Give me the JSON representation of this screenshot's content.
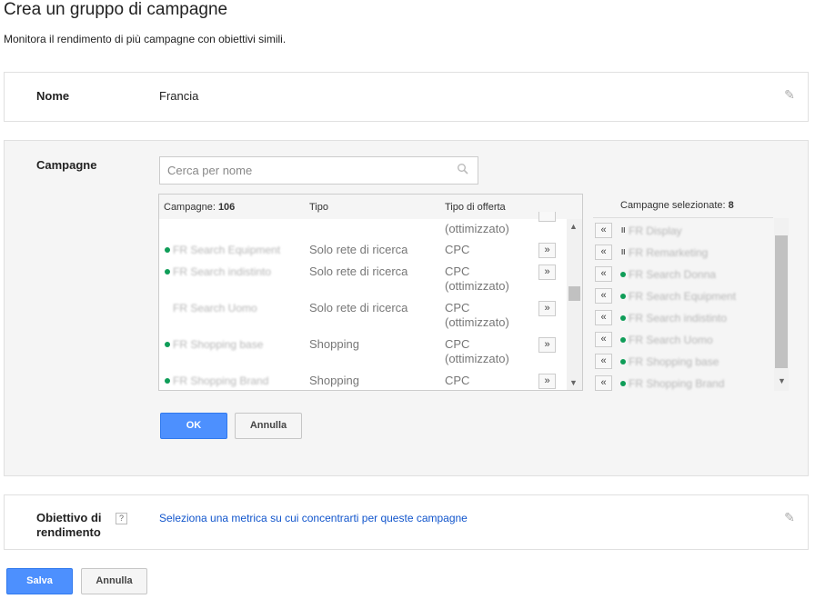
{
  "header": {
    "title": "Crea un gruppo di campagne",
    "subtitle": "Monitora il rendimento di più campagne con obiettivi simili."
  },
  "name_section": {
    "label": "Nome",
    "value": "Francia"
  },
  "campaigns_section": {
    "label": "Campagne",
    "search_placeholder": "Cerca per nome",
    "table": {
      "col_campaigns_label": "Campagne:",
      "col_campaigns_count": "106",
      "col_type": "Tipo",
      "col_bid": "Tipo di offerta",
      "top_partial_bid": "(ottimizzato)",
      "rows": [
        {
          "name": "FR Search Equipment",
          "type": "Solo rete di ricerca",
          "bid1": "CPC",
          "bid2": ""
        },
        {
          "name": "FR Search indistinto",
          "type": "Solo rete di ricerca",
          "bid1": "CPC",
          "bid2": "(ottimizzato)"
        },
        {
          "name": "FR Search Uomo",
          "type": "Solo rete di ricerca",
          "bid1": "CPC",
          "bid2": "(ottimizzato)"
        },
        {
          "name": "FR Shopping base",
          "type": "Shopping",
          "bid1": "CPC",
          "bid2": "(ottimizzato)"
        },
        {
          "name": "FR Shopping Brand",
          "type": "Shopping",
          "bid1": "CPC",
          "bid2": ""
        }
      ],
      "add_arrow": "»"
    },
    "selected": {
      "label": "Campagne selezionate:",
      "count": "8",
      "remove_arrow": "«",
      "items": [
        {
          "name": "FR Display",
          "status": "paused"
        },
        {
          "name": "FR Remarketing",
          "status": "paused"
        },
        {
          "name": "FR Search Donna",
          "status": "active"
        },
        {
          "name": "FR Search Equipment",
          "status": "active"
        },
        {
          "name": "FR Search indistinto",
          "status": "active"
        },
        {
          "name": "FR Search Uomo",
          "status": "active"
        },
        {
          "name": "FR Shopping base",
          "status": "active"
        },
        {
          "name": "FR Shopping Brand",
          "status": "active"
        }
      ]
    },
    "ok_label": "OK",
    "cancel_label": "Annulla"
  },
  "goal_section": {
    "label_line1": "Obiettivo di",
    "label_line2": "rendimento",
    "help": "?",
    "link": "Seleziona una metrica su cui concentrarti per queste campagne"
  },
  "footer": {
    "save_label": "Salva",
    "cancel_label": "Annulla"
  },
  "colors": {
    "accent": "#4d90fe",
    "link": "#1155cc",
    "status_active": "#0f9d58"
  }
}
